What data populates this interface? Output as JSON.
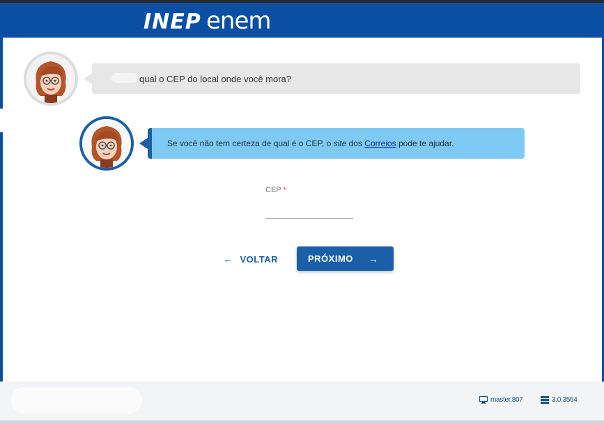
{
  "header": {
    "logo_inep": "INEP",
    "logo_enem": "enem",
    "background_color": "#0a4fa3"
  },
  "chat": {
    "question": "qual o CEP do local onde você mora?",
    "hint_before": "Se você não tem certeza de qual é o CEP, o ",
    "hint_italic": "site",
    "hint_middle": " dos ",
    "hint_link": "Correios",
    "hint_after": " pode te ajudar.",
    "hint_color": "#7ecaf5"
  },
  "form": {
    "cep_label": "CEP",
    "required_mark": "*",
    "cep_value": ""
  },
  "buttons": {
    "back_label": "VOLTAR",
    "back_icon": "arrow-left-icon",
    "next_label": "PRÓXIMO",
    "next_icon": "arrow-right-icon",
    "primary_color": "#1a5fa8"
  },
  "footer": {
    "workstation": "master.807",
    "version": "3.0.3564",
    "workstation_icon": "monitor-icon",
    "version_icon": "server-icon"
  }
}
